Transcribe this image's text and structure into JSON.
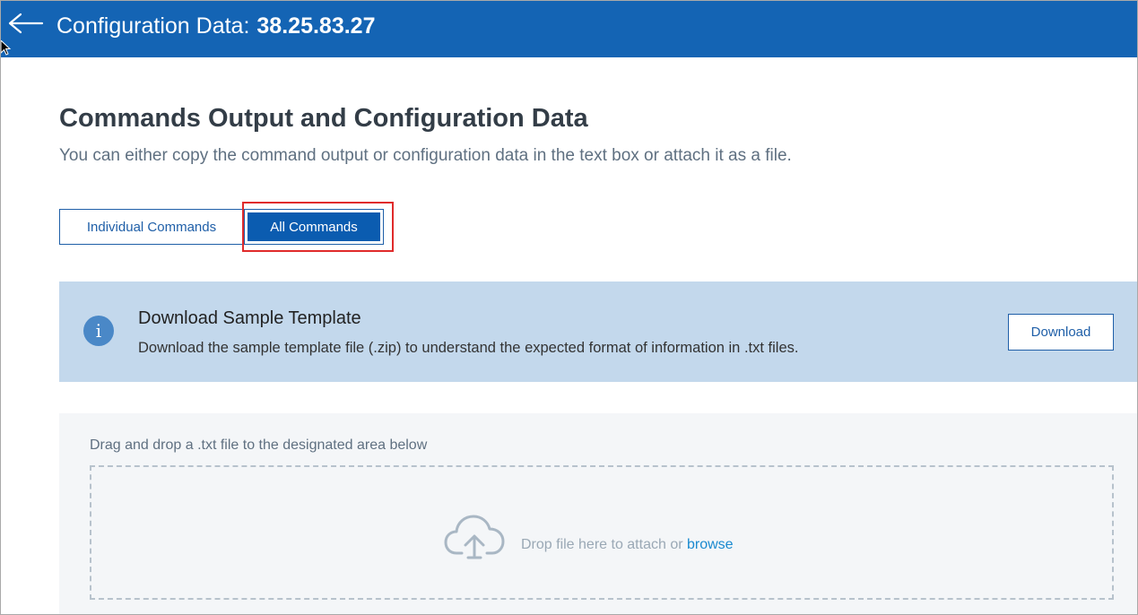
{
  "header": {
    "title_label": "Configuration Data:",
    "title_value": "38.25.83.27"
  },
  "page": {
    "title": "Commands Output and Configuration Data",
    "subtitle": "You can either copy the command output or configuration data in the text box or attach it as a file."
  },
  "tabs": [
    {
      "label": "Individual Commands",
      "selected": false
    },
    {
      "label": "All Commands",
      "selected": true
    }
  ],
  "banner": {
    "icon": "info-icon",
    "title": "Download Sample Template",
    "text": "Download the sample template file (.zip) to understand the expected format of information in .txt files.",
    "button_label": "Download"
  },
  "upload": {
    "instruction": "Drag and drop a .txt file to the designated area below",
    "drop_text": "Drop file here to attach or",
    "browse_label": "browse",
    "icon": "cloud-upload-icon"
  },
  "colors": {
    "header_bg": "#1464b4",
    "banner_bg": "#c3d8ec",
    "primary": "#0b5cb0",
    "highlight": "#e02b2b",
    "link": "#1a8ad0"
  }
}
